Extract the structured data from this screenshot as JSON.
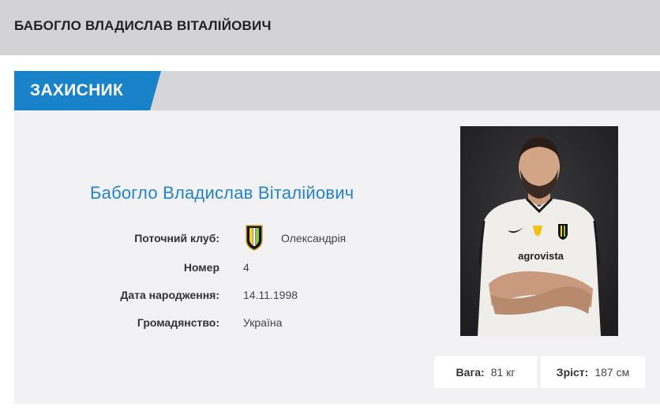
{
  "header": {
    "title": "БАБОГЛО ВЛАДИСЛАВ ВІТАЛІЙОВИЧ"
  },
  "position": {
    "label": "ЗАХИСНИК"
  },
  "player": {
    "full_name": "Бабогло Владислав Віталійович",
    "club_label": "Поточний клуб:",
    "club_value": "Олександрія",
    "number_label": "Номер",
    "number_value": "4",
    "birth_label": "Дата народження:",
    "birth_value": "14.11.1998",
    "citizenship_label": "Громадянство:",
    "citizenship_value": "Україна"
  },
  "stats": {
    "weight_label": "Вага:",
    "weight_value": "81 кг",
    "height_label": "Зріст:",
    "height_value": "187 см"
  },
  "colors": {
    "accent": "#1a82c8",
    "name_blue": "#2583c6",
    "header_bg": "#d3d3d6",
    "card_bg": "#f2f1f3"
  },
  "icons": {
    "club_logo": "club-crest-icon"
  }
}
